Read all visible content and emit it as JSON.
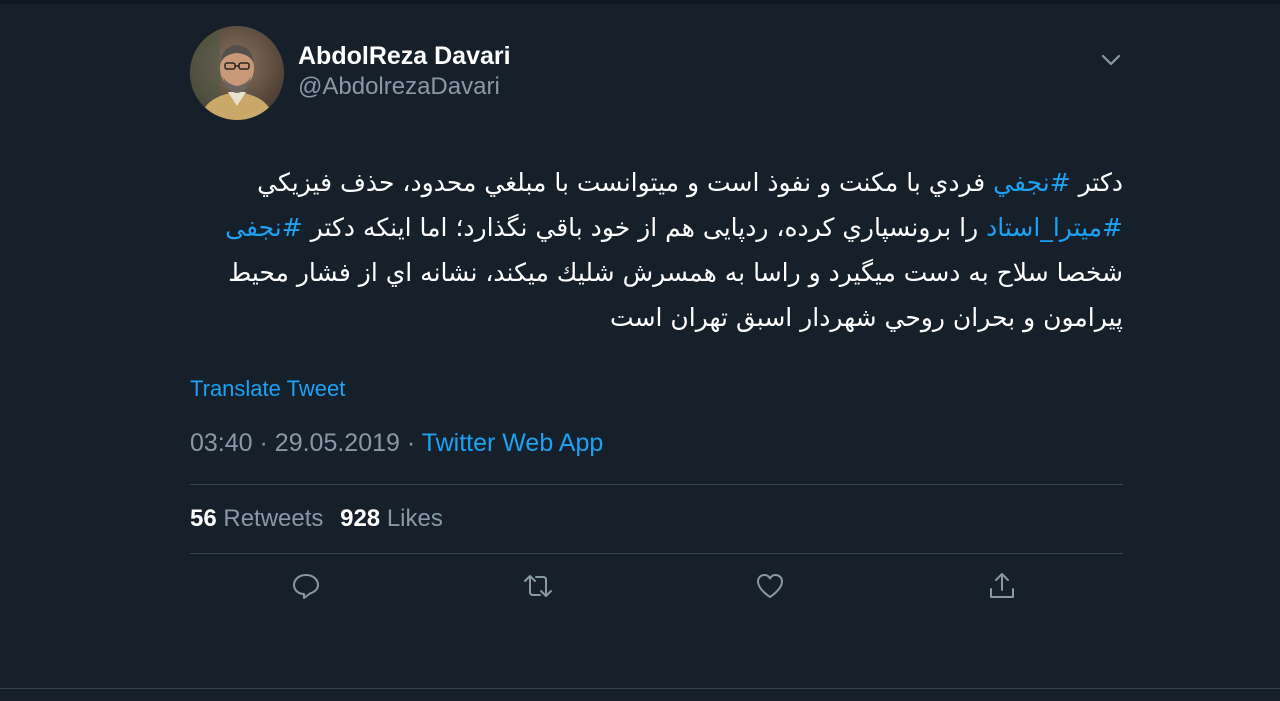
{
  "author": {
    "display_name": "AbdolReza Davari",
    "handle": "@AbdolrezaDavari"
  },
  "tweet": {
    "segments": [
      {
        "text": "دکتر ",
        "type": "text"
      },
      {
        "text": "#نجفي",
        "type": "hashtag"
      },
      {
        "text": " فردي با مکنت و نفوذ است و میتوانست با مبلغي محدود، حذف فیزیکي ",
        "type": "text"
      },
      {
        "text": "#میترا_استاد",
        "type": "hashtag"
      },
      {
        "text": " را برونسپاري کرده، ردپایی هم از خود باقي نگذارد؛ اما اینکه دکتر ",
        "type": "text"
      },
      {
        "text": "#نجفی",
        "type": "hashtag"
      },
      {
        "text": " شخصا سلاح به دست میگیرد و راسا به همسرش شلیك میکند، نشانه اي از فشار محیط پیرامون و بحران روحي شهردار اسبق تهران است",
        "type": "text"
      }
    ],
    "translate_label": "Translate Tweet",
    "time": "03:40",
    "date": "29.05.2019",
    "source": "Twitter Web App",
    "separator": "·"
  },
  "stats": {
    "retweets_count": "56",
    "retweets_label": "Retweets",
    "likes_count": "928",
    "likes_label": "Likes"
  },
  "colors": {
    "background": "#15202b",
    "accent": "#1da1f2",
    "secondary_text": "#8899a6",
    "divider": "#38444d"
  },
  "icons": {
    "caret": "chevron-down-icon",
    "reply": "reply-icon",
    "retweet": "retweet-icon",
    "like": "heart-icon",
    "share": "share-icon"
  }
}
